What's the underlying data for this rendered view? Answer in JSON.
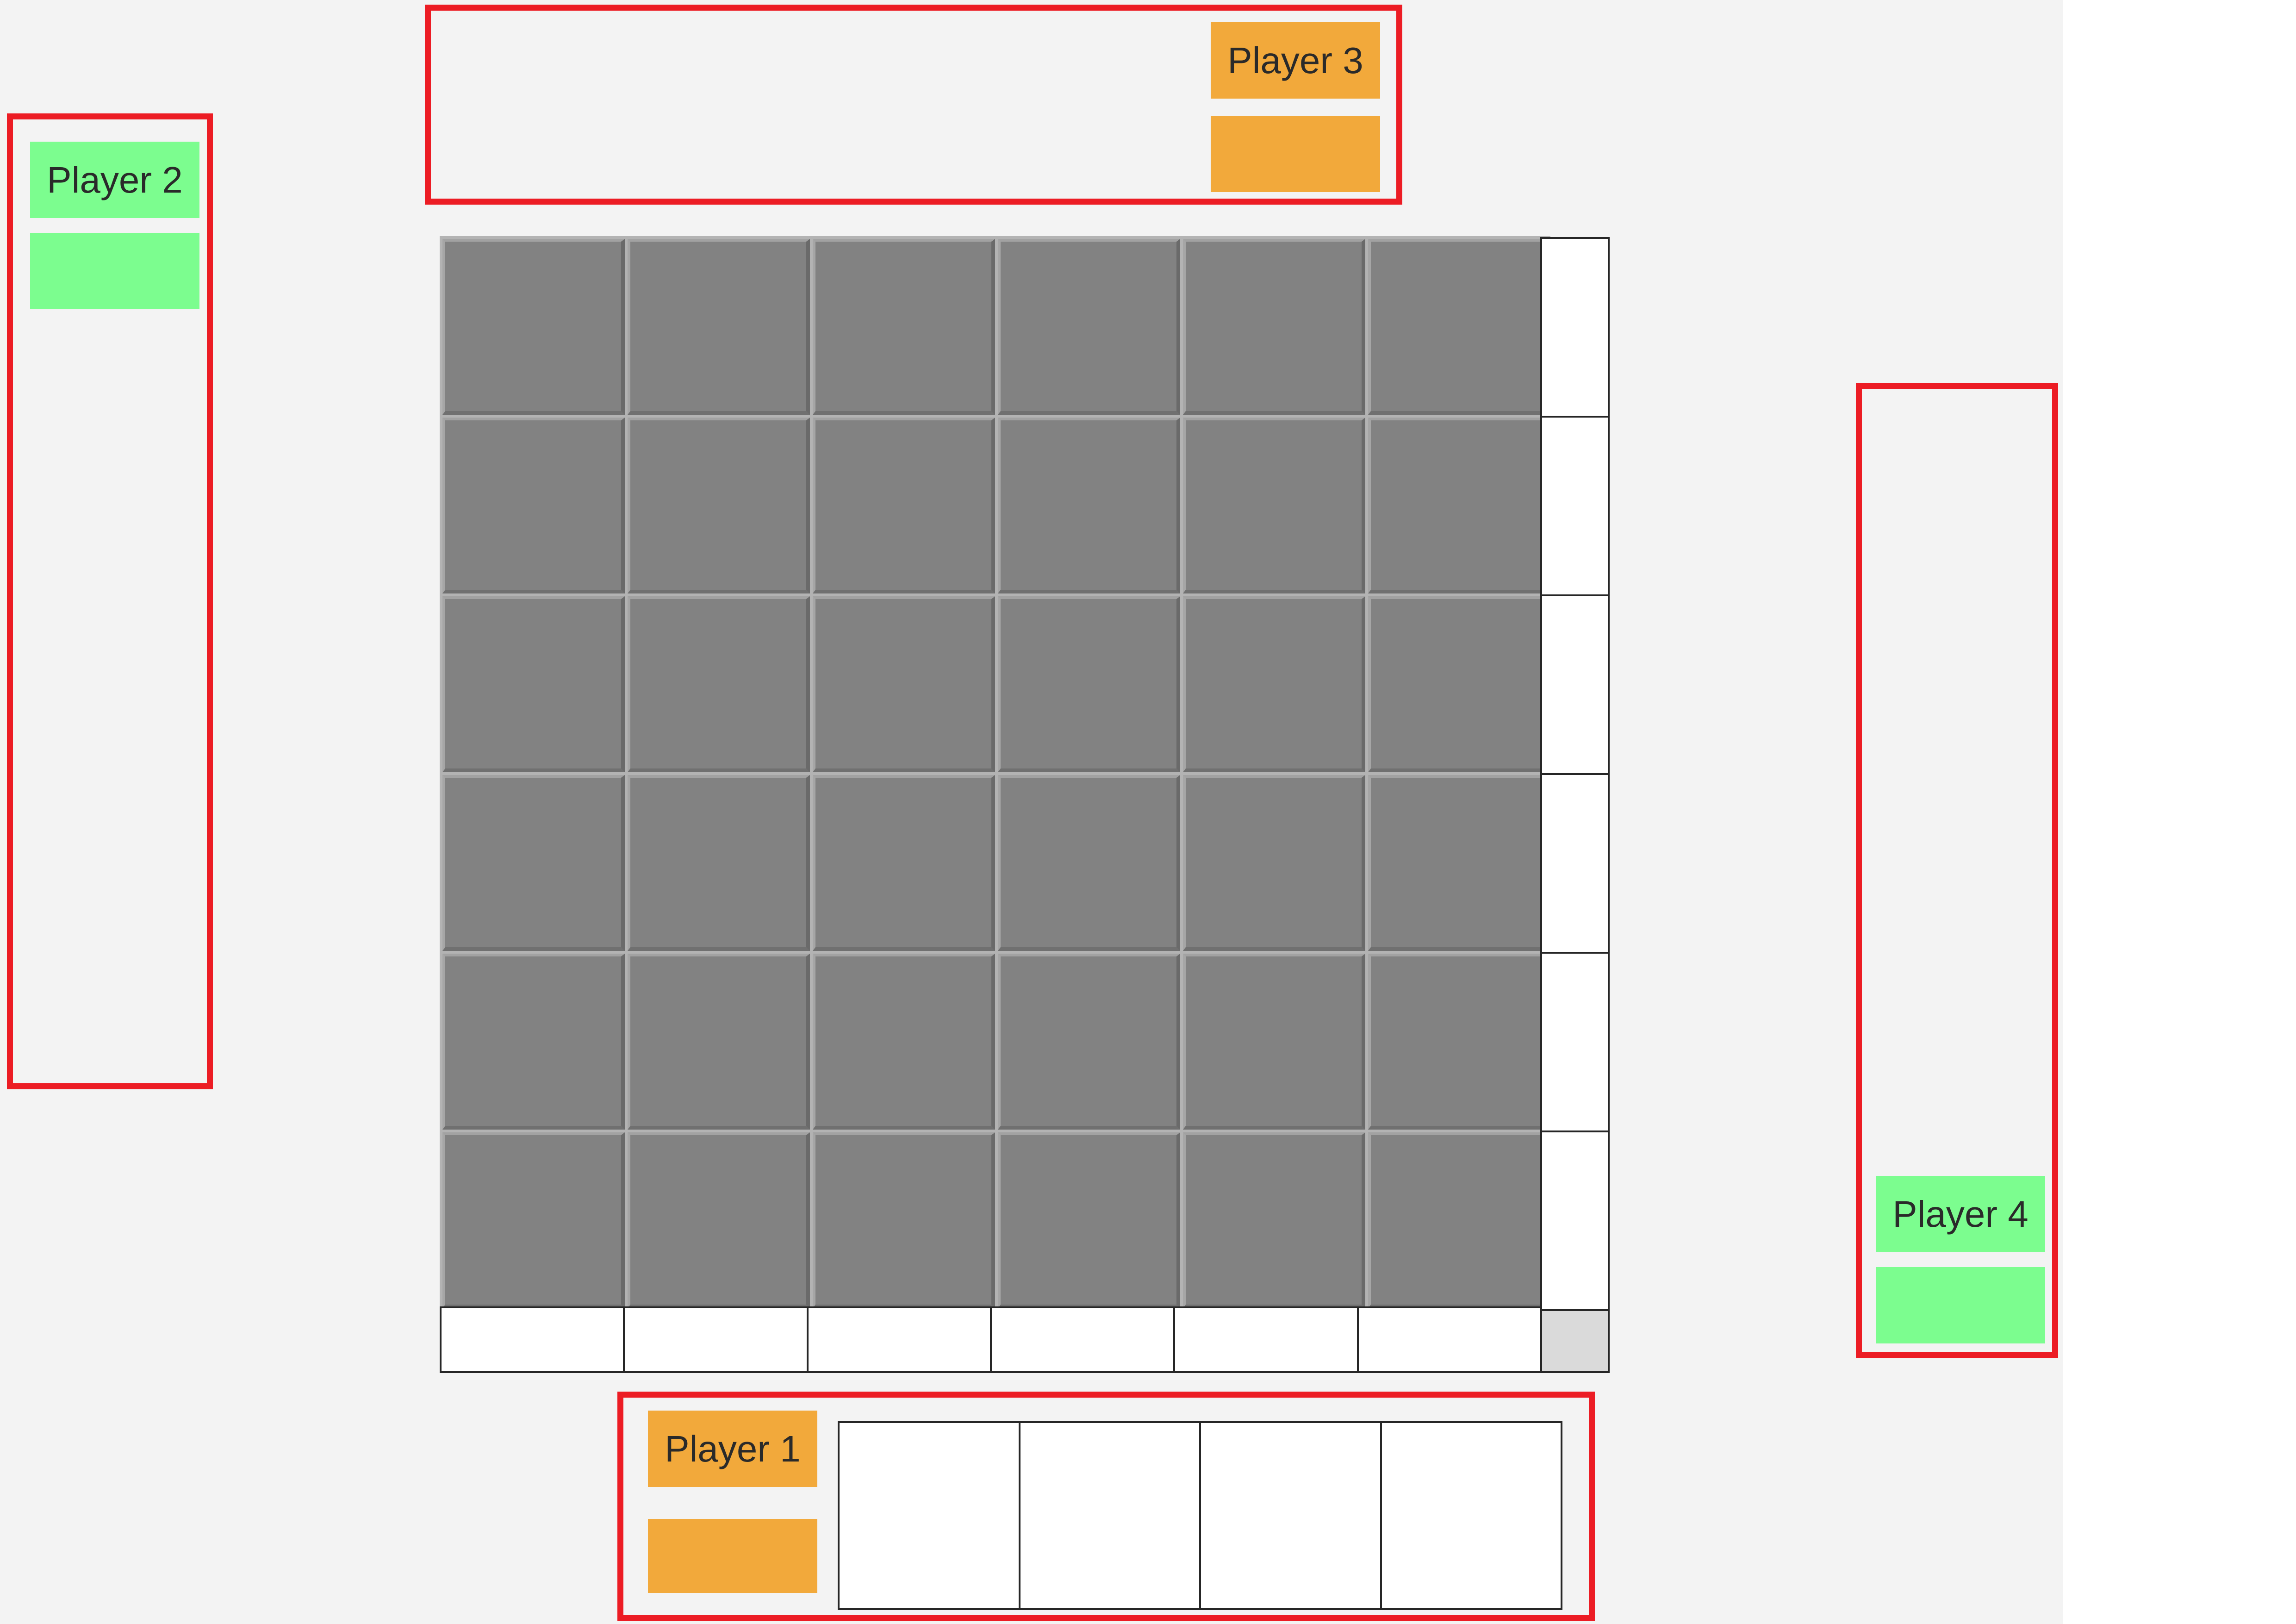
{
  "players": [
    {
      "id": "p1",
      "label": "Player 1",
      "color": "#f2a93b"
    },
    {
      "id": "p2",
      "label": "Player 2",
      "color": "#7cfd8f"
    },
    {
      "id": "p3",
      "label": "Player 3",
      "color": "#f2a93b"
    },
    {
      "id": "p4",
      "label": "Player 4",
      "color": "#7cfd8f"
    }
  ],
  "board": {
    "rows": 6,
    "cols": 6,
    "tile_color": "#828282"
  },
  "column_slots": 6,
  "row_slots": 6,
  "hand": {
    "slots": 4
  },
  "zone_border_color": "#ec1c24"
}
